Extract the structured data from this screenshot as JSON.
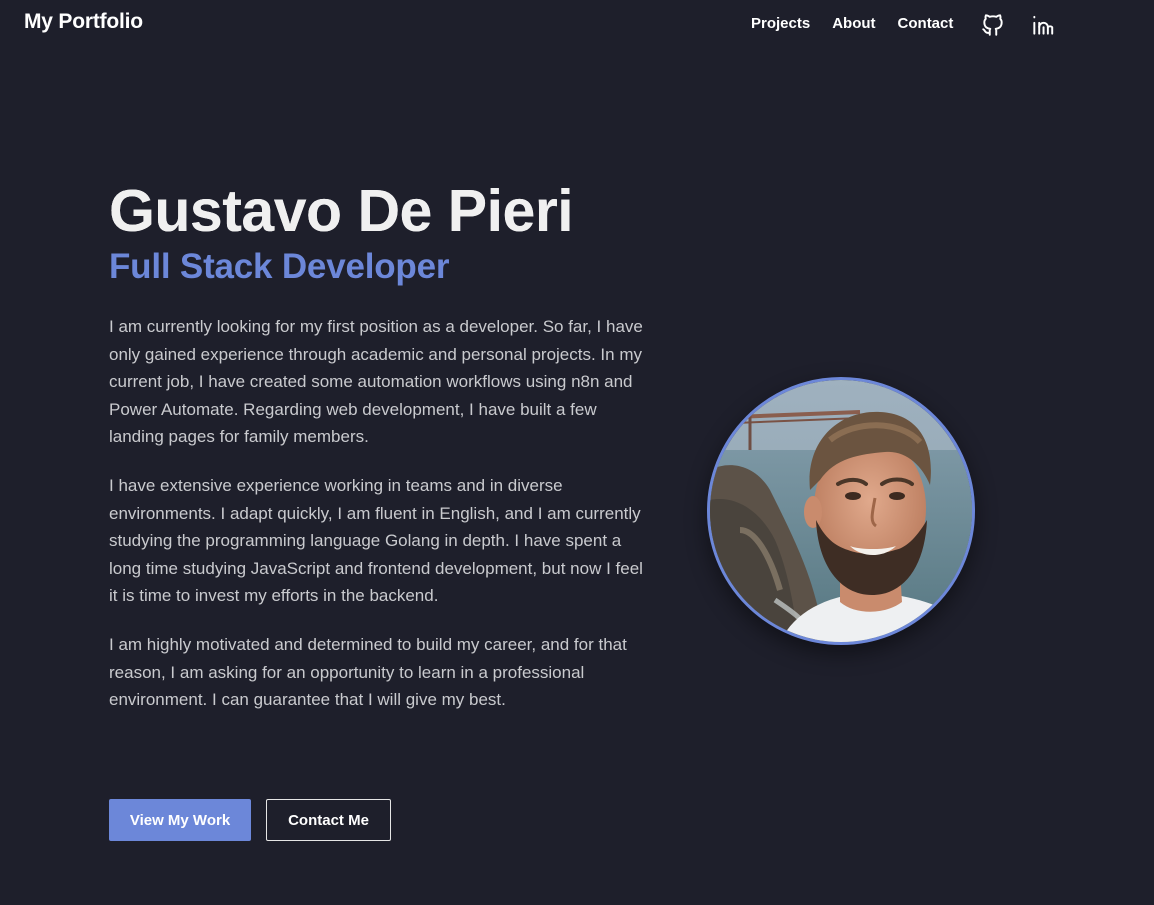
{
  "header": {
    "brand": "My Portfolio",
    "nav": [
      {
        "label": "Projects"
      },
      {
        "label": "About"
      },
      {
        "label": "Contact"
      }
    ],
    "social": [
      {
        "icon": "github-icon"
      },
      {
        "icon": "linkedin-icon"
      }
    ]
  },
  "hero": {
    "name": "Gustavo De Pieri",
    "role": "Full Stack Developer",
    "paragraphs": [
      "I am currently looking for my first position as a developer. So far, I have only gained experience through academic and personal projects. In my current job, I have created some automation workflows using n8n and Power Automate. Regarding web development, I have built a few landing pages for family members.",
      "I have extensive experience working in teams and in diverse environments. I adapt quickly, I am fluent in English, and I am currently studying the programming language Golang in depth. I have spent a long time studying JavaScript and frontend development, but now I feel it is time to invest my efforts in the backend.",
      "I am highly motivated and determined to build my career, and for that reason, I am asking for an opportunity to learn in a professional environment. I can guarantee that I will give my best."
    ],
    "primary_button": "View My Work",
    "secondary_button": "Contact Me"
  },
  "colors": {
    "background": "#1e1f2b",
    "accent": "#6c87d9",
    "text": "#c9cace"
  }
}
